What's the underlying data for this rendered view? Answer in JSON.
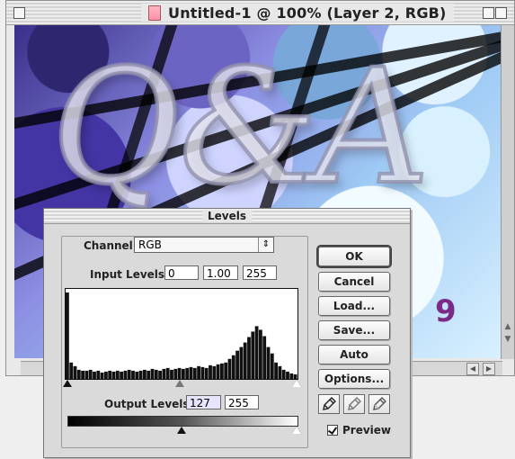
{
  "window": {
    "title": "Untitled-1 @ 100% (Layer 2, RGB)",
    "zoom_readout": "1"
  },
  "canvas": {
    "letters": "Q&A",
    "number": "9"
  },
  "levels": {
    "title": "Levels",
    "channel_label": "Channel:",
    "channel_value": "RGB",
    "input_label": "Input Levels:",
    "input_values": [
      "0",
      "1.00",
      "255"
    ],
    "output_label": "Output Levels:",
    "output_values": [
      "127",
      "255"
    ],
    "buttons": [
      "OK",
      "Cancel",
      "Load...",
      "Save...",
      "Auto",
      "Options..."
    ],
    "preview_label": "Preview",
    "preview_checked": true,
    "histogram_data": [
      95,
      18,
      14,
      10,
      9,
      9,
      10,
      8,
      9,
      7,
      8,
      9,
      8,
      9,
      8,
      9,
      10,
      9,
      8,
      9,
      10,
      9,
      11,
      10,
      9,
      11,
      12,
      10,
      11,
      12,
      11,
      12,
      13,
      12,
      14,
      13,
      12,
      15,
      14,
      16,
      17,
      18,
      22,
      26,
      31,
      35,
      40,
      46,
      52,
      58,
      54,
      47,
      35,
      28,
      18,
      14,
      10,
      8,
      6,
      5
    ],
    "output_black": 127,
    "output_white": 255,
    "colors": {
      "dialog": "#dadada",
      "histogram": "#111111"
    }
  }
}
